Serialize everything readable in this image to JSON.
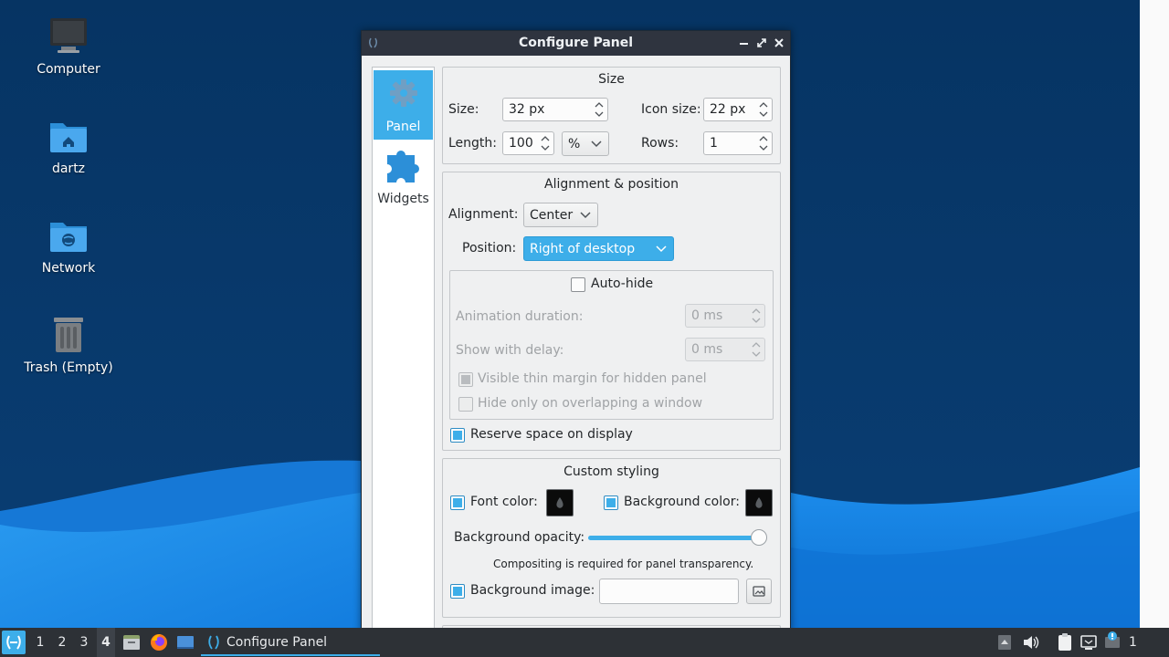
{
  "desktop": {
    "icons": [
      {
        "label": "Computer",
        "icon": "computer-icon"
      },
      {
        "label": "dartz",
        "icon": "home-folder-icon"
      },
      {
        "label": "Network",
        "icon": "network-folder-icon"
      },
      {
        "label": "Trash (Empty)",
        "icon": "trash-icon"
      }
    ]
  },
  "window": {
    "title": "Configure Panel",
    "sidebar": [
      {
        "label": "Panel",
        "icon": "gear-icon",
        "active": true
      },
      {
        "label": "Widgets",
        "icon": "puzzle-icon",
        "active": false
      }
    ],
    "size_group": {
      "title": "Size",
      "size_label": "Size:",
      "size_value": "32 px",
      "icon_size_label": "Icon size:",
      "icon_size_value": "22 px",
      "length_label": "Length:",
      "length_value": "100",
      "length_unit": "%",
      "rows_label": "Rows:",
      "rows_value": "1"
    },
    "alignment_group": {
      "title": "Alignment & position",
      "alignment_label": "Alignment:",
      "alignment_value": "Center",
      "position_label": "Position:",
      "position_value": "Right of desktop",
      "autohide_label": "Auto-hide",
      "autohide_checked": false,
      "animation_label": "Animation duration:",
      "animation_value": "0 ms",
      "delay_label": "Show with delay:",
      "delay_value": "0 ms",
      "thin_margin_label": "Visible thin margin for hidden panel",
      "thin_margin_checked": true,
      "overlap_label": "Hide only on overlapping a window",
      "overlap_checked": false,
      "reserve_label": "Reserve space on display",
      "reserve_checked": true
    },
    "styling_group": {
      "title": "Custom styling",
      "font_color_label": "Font color:",
      "font_color_checked": true,
      "bg_color_label": "Background color:",
      "bg_color_checked": true,
      "opacity_label": "Background opacity:",
      "opacity_value": 1.0,
      "compositing_note": "Compositing is required for panel transparency.",
      "bg_image_label": "Background image:",
      "bg_image_checked": true,
      "bg_image_value": ""
    }
  },
  "taskbar": {
    "workspaces": [
      "1",
      "2",
      "3",
      "4"
    ],
    "current_workspace": "4",
    "task_label": "Configure Panel",
    "clock_partial": "1"
  },
  "colors": {
    "accent": "#3daee9",
    "titlebar": "#2f343f",
    "window_bg": "#eff0f1",
    "taskbar": "#2d3136",
    "desktop_bg": "#0b3a6e"
  }
}
